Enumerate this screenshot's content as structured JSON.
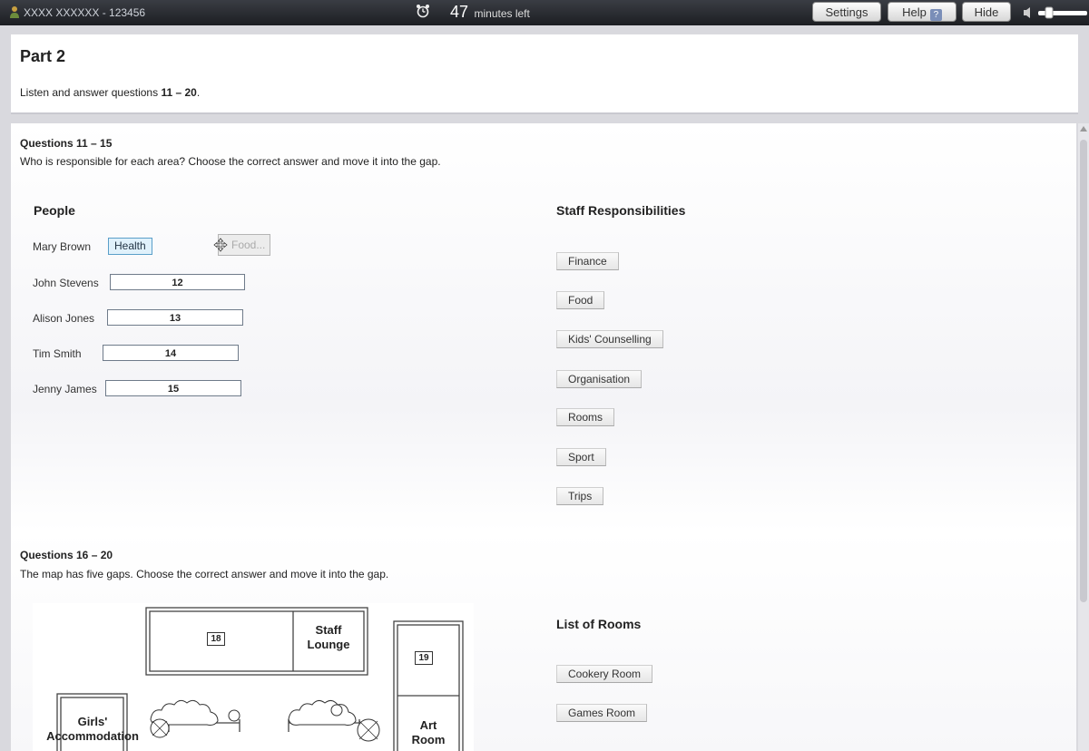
{
  "topbar": {
    "candidate": "XXXX XXXXXX - 123456",
    "timer_minutes": "47",
    "timer_suffix": "minutes left",
    "settings_label": "Settings",
    "help_label": "Help",
    "help_badge": "?",
    "hide_label": "Hide"
  },
  "header": {
    "title": "Part 2",
    "instruction_prefix": "Listen and answer questions ",
    "instruction_range": "11 – 20",
    "instruction_suffix": "."
  },
  "section1": {
    "heading": "Questions 11 – 15",
    "instruction": "Who is responsible for each area? Choose the correct answer and move it into the gap.",
    "people_title": "People",
    "people": [
      {
        "name": "Mary Brown",
        "answer": "Health"
      },
      {
        "name": "John Stevens",
        "gap": "12"
      },
      {
        "name": "Alison Jones",
        "gap": "13"
      },
      {
        "name": "Tim Smith",
        "gap": "14"
      },
      {
        "name": "Jenny James",
        "gap": "15"
      }
    ],
    "dragging_item": "Food...",
    "options_title": "Staff Responsibilities",
    "options": [
      "Finance",
      "Food",
      "Kids' Counselling",
      "Organisation",
      "Rooms",
      "Sport",
      "Trips"
    ]
  },
  "section2": {
    "heading": "Questions 16 – 20",
    "instruction": "The map has five gaps. Choose the correct answer and move it into the gap.",
    "map": {
      "gap_18": "18",
      "gap_19": "19",
      "staff_lounge": "Staff\nLounge",
      "girls_accommodation": "Girls'\nAccommodation",
      "art_room": "Art\nRoom"
    },
    "rooms_title": "List of Rooms",
    "rooms": [
      "Cookery Room",
      "Games Room"
    ]
  }
}
